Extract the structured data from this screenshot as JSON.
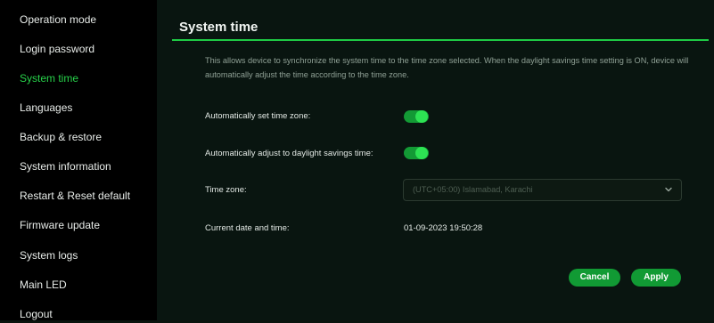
{
  "sidebar": {
    "items": [
      {
        "label": "Operation mode"
      },
      {
        "label": "Login password"
      },
      {
        "label": "System time",
        "active": true
      },
      {
        "label": "Languages"
      },
      {
        "label": "Backup & restore"
      },
      {
        "label": "System information"
      },
      {
        "label": "Restart & Reset default"
      },
      {
        "label": "Firmware update"
      },
      {
        "label": "System logs"
      },
      {
        "label": "Main LED"
      },
      {
        "label": "Logout"
      }
    ]
  },
  "main": {
    "title": "System time",
    "description": "This allows device to synchronize the system time to the time zone selected. When the daylight savings time setting is ON, device will automatically adjust the time according to the time zone.",
    "auto_timezone": {
      "label": "Automatically set time zone:",
      "enabled": true
    },
    "auto_dst": {
      "label": "Automatically adjust to daylight savings time:",
      "enabled": true
    },
    "time_zone": {
      "label": "Time zone:",
      "value": "(UTC+05:00) Islamabad, Karachi",
      "icon": "chevron-down-icon"
    },
    "current_datetime": {
      "label": "Current date and time:",
      "value": "01-09-2023 19:50:28"
    },
    "buttons": {
      "cancel": "Cancel",
      "apply": "Apply"
    }
  },
  "colors": {
    "accent": "#1ecb45",
    "active_text": "#27d24a",
    "button_bg": "#119a34",
    "sidebar_bg": "#000000",
    "main_bg": "#091510"
  }
}
